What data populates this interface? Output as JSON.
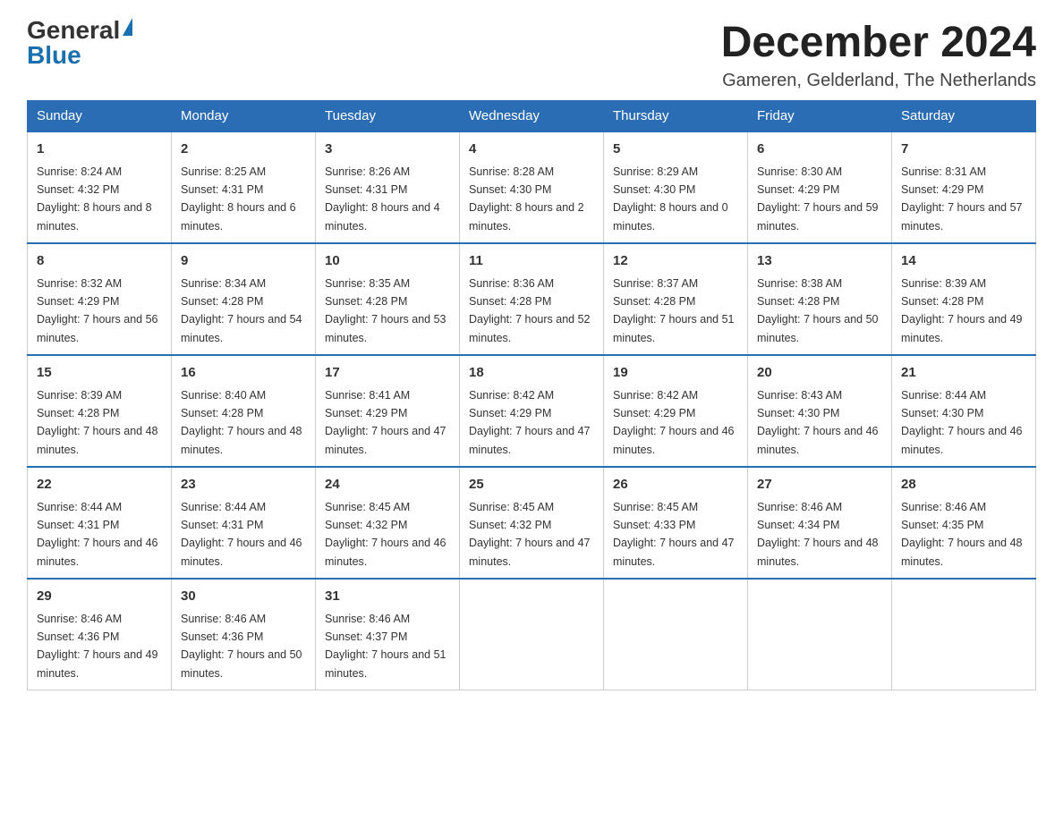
{
  "logo": {
    "general": "General",
    "blue": "Blue",
    "triangle": "▶"
  },
  "title": "December 2024",
  "subtitle": "Gameren, Gelderland, The Netherlands",
  "days_of_week": [
    "Sunday",
    "Monday",
    "Tuesday",
    "Wednesday",
    "Thursday",
    "Friday",
    "Saturday"
  ],
  "weeks": [
    [
      {
        "day": "1",
        "sunrise": "8:24 AM",
        "sunset": "4:32 PM",
        "daylight": "8 hours and 8 minutes."
      },
      {
        "day": "2",
        "sunrise": "8:25 AM",
        "sunset": "4:31 PM",
        "daylight": "8 hours and 6 minutes."
      },
      {
        "day": "3",
        "sunrise": "8:26 AM",
        "sunset": "4:31 PM",
        "daylight": "8 hours and 4 minutes."
      },
      {
        "day": "4",
        "sunrise": "8:28 AM",
        "sunset": "4:30 PM",
        "daylight": "8 hours and 2 minutes."
      },
      {
        "day": "5",
        "sunrise": "8:29 AM",
        "sunset": "4:30 PM",
        "daylight": "8 hours and 0 minutes."
      },
      {
        "day": "6",
        "sunrise": "8:30 AM",
        "sunset": "4:29 PM",
        "daylight": "7 hours and 59 minutes."
      },
      {
        "day": "7",
        "sunrise": "8:31 AM",
        "sunset": "4:29 PM",
        "daylight": "7 hours and 57 minutes."
      }
    ],
    [
      {
        "day": "8",
        "sunrise": "8:32 AM",
        "sunset": "4:29 PM",
        "daylight": "7 hours and 56 minutes."
      },
      {
        "day": "9",
        "sunrise": "8:34 AM",
        "sunset": "4:28 PM",
        "daylight": "7 hours and 54 minutes."
      },
      {
        "day": "10",
        "sunrise": "8:35 AM",
        "sunset": "4:28 PM",
        "daylight": "7 hours and 53 minutes."
      },
      {
        "day": "11",
        "sunrise": "8:36 AM",
        "sunset": "4:28 PM",
        "daylight": "7 hours and 52 minutes."
      },
      {
        "day": "12",
        "sunrise": "8:37 AM",
        "sunset": "4:28 PM",
        "daylight": "7 hours and 51 minutes."
      },
      {
        "day": "13",
        "sunrise": "8:38 AM",
        "sunset": "4:28 PM",
        "daylight": "7 hours and 50 minutes."
      },
      {
        "day": "14",
        "sunrise": "8:39 AM",
        "sunset": "4:28 PM",
        "daylight": "7 hours and 49 minutes."
      }
    ],
    [
      {
        "day": "15",
        "sunrise": "8:39 AM",
        "sunset": "4:28 PM",
        "daylight": "7 hours and 48 minutes."
      },
      {
        "day": "16",
        "sunrise": "8:40 AM",
        "sunset": "4:28 PM",
        "daylight": "7 hours and 48 minutes."
      },
      {
        "day": "17",
        "sunrise": "8:41 AM",
        "sunset": "4:29 PM",
        "daylight": "7 hours and 47 minutes."
      },
      {
        "day": "18",
        "sunrise": "8:42 AM",
        "sunset": "4:29 PM",
        "daylight": "7 hours and 47 minutes."
      },
      {
        "day": "19",
        "sunrise": "8:42 AM",
        "sunset": "4:29 PM",
        "daylight": "7 hours and 46 minutes."
      },
      {
        "day": "20",
        "sunrise": "8:43 AM",
        "sunset": "4:30 PM",
        "daylight": "7 hours and 46 minutes."
      },
      {
        "day": "21",
        "sunrise": "8:44 AM",
        "sunset": "4:30 PM",
        "daylight": "7 hours and 46 minutes."
      }
    ],
    [
      {
        "day": "22",
        "sunrise": "8:44 AM",
        "sunset": "4:31 PM",
        "daylight": "7 hours and 46 minutes."
      },
      {
        "day": "23",
        "sunrise": "8:44 AM",
        "sunset": "4:31 PM",
        "daylight": "7 hours and 46 minutes."
      },
      {
        "day": "24",
        "sunrise": "8:45 AM",
        "sunset": "4:32 PM",
        "daylight": "7 hours and 46 minutes."
      },
      {
        "day": "25",
        "sunrise": "8:45 AM",
        "sunset": "4:32 PM",
        "daylight": "7 hours and 47 minutes."
      },
      {
        "day": "26",
        "sunrise": "8:45 AM",
        "sunset": "4:33 PM",
        "daylight": "7 hours and 47 minutes."
      },
      {
        "day": "27",
        "sunrise": "8:46 AM",
        "sunset": "4:34 PM",
        "daylight": "7 hours and 48 minutes."
      },
      {
        "day": "28",
        "sunrise": "8:46 AM",
        "sunset": "4:35 PM",
        "daylight": "7 hours and 48 minutes."
      }
    ],
    [
      {
        "day": "29",
        "sunrise": "8:46 AM",
        "sunset": "4:36 PM",
        "daylight": "7 hours and 49 minutes."
      },
      {
        "day": "30",
        "sunrise": "8:46 AM",
        "sunset": "4:36 PM",
        "daylight": "7 hours and 50 minutes."
      },
      {
        "day": "31",
        "sunrise": "8:46 AM",
        "sunset": "4:37 PM",
        "daylight": "7 hours and 51 minutes."
      },
      null,
      null,
      null,
      null
    ]
  ],
  "labels": {
    "sunrise_prefix": "Sunrise: ",
    "sunset_prefix": "Sunset: ",
    "daylight_prefix": "Daylight: "
  }
}
